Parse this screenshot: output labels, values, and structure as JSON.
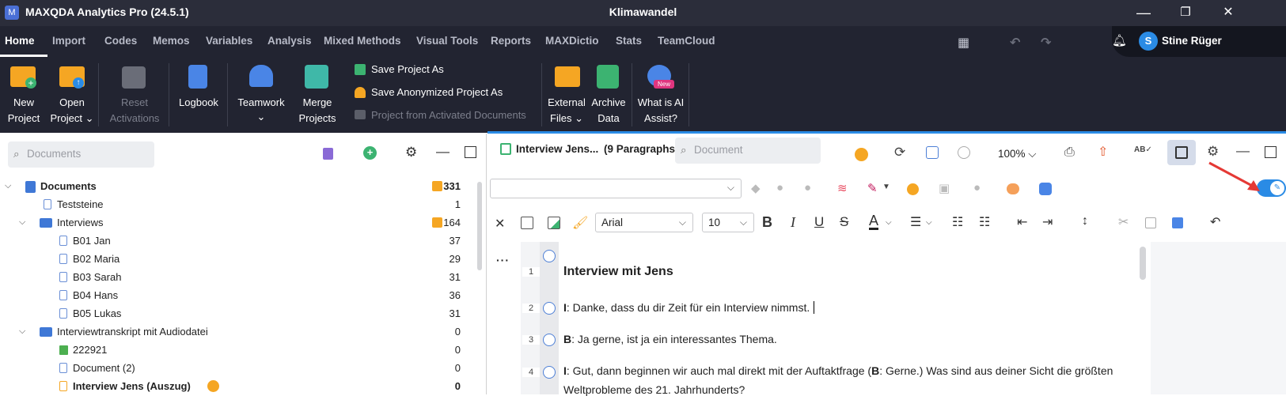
{
  "titlebar": {
    "app_title": "MAXQDA Analytics Pro (24.5.1)",
    "project": "Klimawandel",
    "minimize": "—",
    "restore": "❐",
    "close": "✕"
  },
  "tabs": [
    "Home",
    "Import",
    "Codes",
    "Memos",
    "Variables",
    "Analysis",
    "Mixed Methods",
    "Visual Tools",
    "Reports",
    "MAXDictio",
    "Stats",
    "TeamCloud"
  ],
  "user": {
    "initial": "S",
    "name": "Stine Rüger"
  },
  "ribbon": {
    "new_project": [
      "New",
      "Project"
    ],
    "open_project": [
      "Open",
      "Project ⌄"
    ],
    "reset_activations": [
      "Reset",
      "Activations"
    ],
    "logbook": "Logbook",
    "teamwork": [
      "Teamwork",
      "⌄"
    ],
    "merge_projects": [
      "Merge",
      "Projects"
    ],
    "save_project_as": "Save Project As",
    "save_anonymized": "Save Anonymized Project As",
    "project_from_activated": "Project from Activated Documents",
    "external_files": [
      "External",
      "Files ⌄"
    ],
    "archive_data": [
      "Archive",
      "Data"
    ],
    "ai_assist": [
      "What is AI",
      "Assist?"
    ],
    "ai_badge": "New"
  },
  "documents_panel": {
    "search_placeholder": "Documents",
    "tree": [
      {
        "label": "Documents",
        "count": "331",
        "bold": true
      },
      {
        "label": "Teststeine",
        "count": "1"
      },
      {
        "label": "Interviews",
        "count": "164"
      },
      {
        "label": "B01 Jan",
        "count": "37"
      },
      {
        "label": "B02 Maria",
        "count": "29"
      },
      {
        "label": "B03 Sarah",
        "count": "31"
      },
      {
        "label": "B04 Hans",
        "count": "36"
      },
      {
        "label": "B05 Lukas",
        "count": "31"
      },
      {
        "label": "Interviewtranskript mit Audiodatei",
        "count": "0"
      },
      {
        "label": "222921",
        "count": "0"
      },
      {
        "label": "Document (2)",
        "count": "0"
      },
      {
        "label": "Interview Jens (Auszug)",
        "count": "0"
      }
    ]
  },
  "browser": {
    "doc_title": "Interview Jens...",
    "paragraphs": "(9 Paragraphs)",
    "search_placeholder": "Document",
    "zoom": "100%",
    "font": "Arial",
    "font_size": "10"
  },
  "document": {
    "lines": [
      {
        "num": "1",
        "text": "Interview mit Jens"
      },
      {
        "num": "2",
        "speaker": "I",
        "text": ": Danke, dass du dir Zeit für ein Interview nimmst."
      },
      {
        "num": "3",
        "speaker": "B",
        "text": ": Ja gerne, ist ja ein interessantes Thema."
      },
      {
        "num": "4",
        "speaker": "I",
        "text": ": Gut, dann beginnen wir auch mal direkt mit der Auftaktfrage (",
        "speaker2": "B",
        "text2": ": Gerne.) Was sind aus deiner Sicht die größten"
      },
      {
        "text": "Weltprobleme des 21. Jahrhunderts?"
      }
    ]
  },
  "colors": {
    "accent": "#2a8be5",
    "dark": "#222431",
    "folder": "#f5a623"
  }
}
